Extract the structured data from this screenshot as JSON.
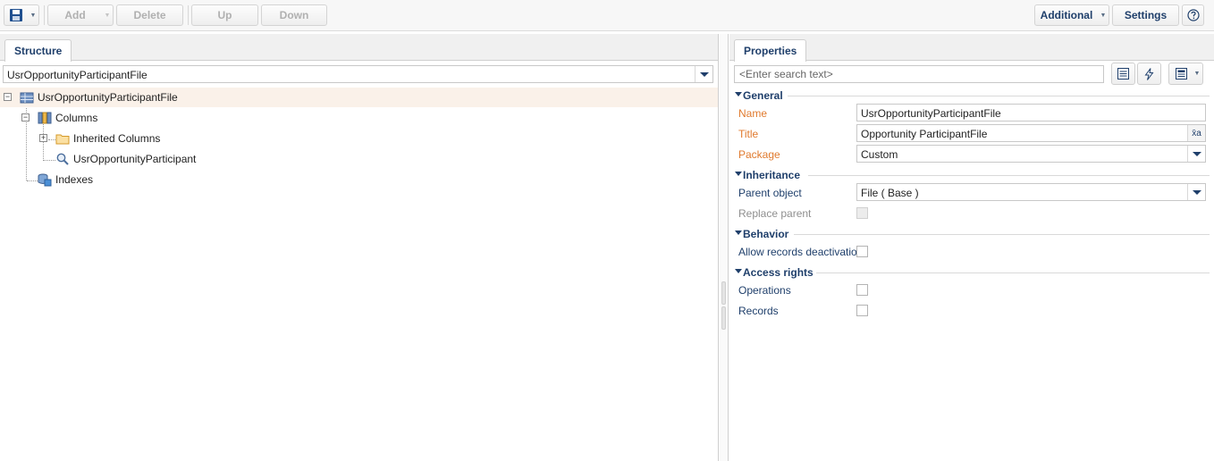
{
  "toolbar": {
    "add_label": "Add",
    "delete_label": "Delete",
    "up_label": "Up",
    "down_label": "Down",
    "additional_label": "Additional",
    "settings_label": "Settings"
  },
  "structure": {
    "tab_label": "Structure",
    "object_selector_value": "UsrOpportunityParticipantFile",
    "tree": {
      "root": "UsrOpportunityParticipantFile",
      "columns": "Columns",
      "inherited_columns": "Inherited Columns",
      "lookup_column": "UsrOpportunityParticipant",
      "indexes": "Indexes"
    }
  },
  "properties": {
    "tab_label": "Properties",
    "search_placeholder": "<Enter search text>",
    "groups": {
      "general": "General",
      "inheritance": "Inheritance",
      "behavior": "Behavior",
      "access_rights": "Access rights"
    },
    "name_label": "Name",
    "name_value": "UsrOpportunityParticipantFile",
    "title_label": "Title",
    "title_value": "Opportunity ParticipantFile",
    "package_label": "Package",
    "package_value": "Custom",
    "parent_object_label": "Parent object",
    "parent_object_value": "File ( Base )",
    "replace_parent_label": "Replace parent",
    "allow_deactivation_label": "Allow records deactivation",
    "operations_label": "Operations",
    "records_label": "Records"
  },
  "colors": {
    "accent": "#1f3f6b",
    "required_label": "#e07a2e",
    "selected_row": "#faf1e9"
  }
}
